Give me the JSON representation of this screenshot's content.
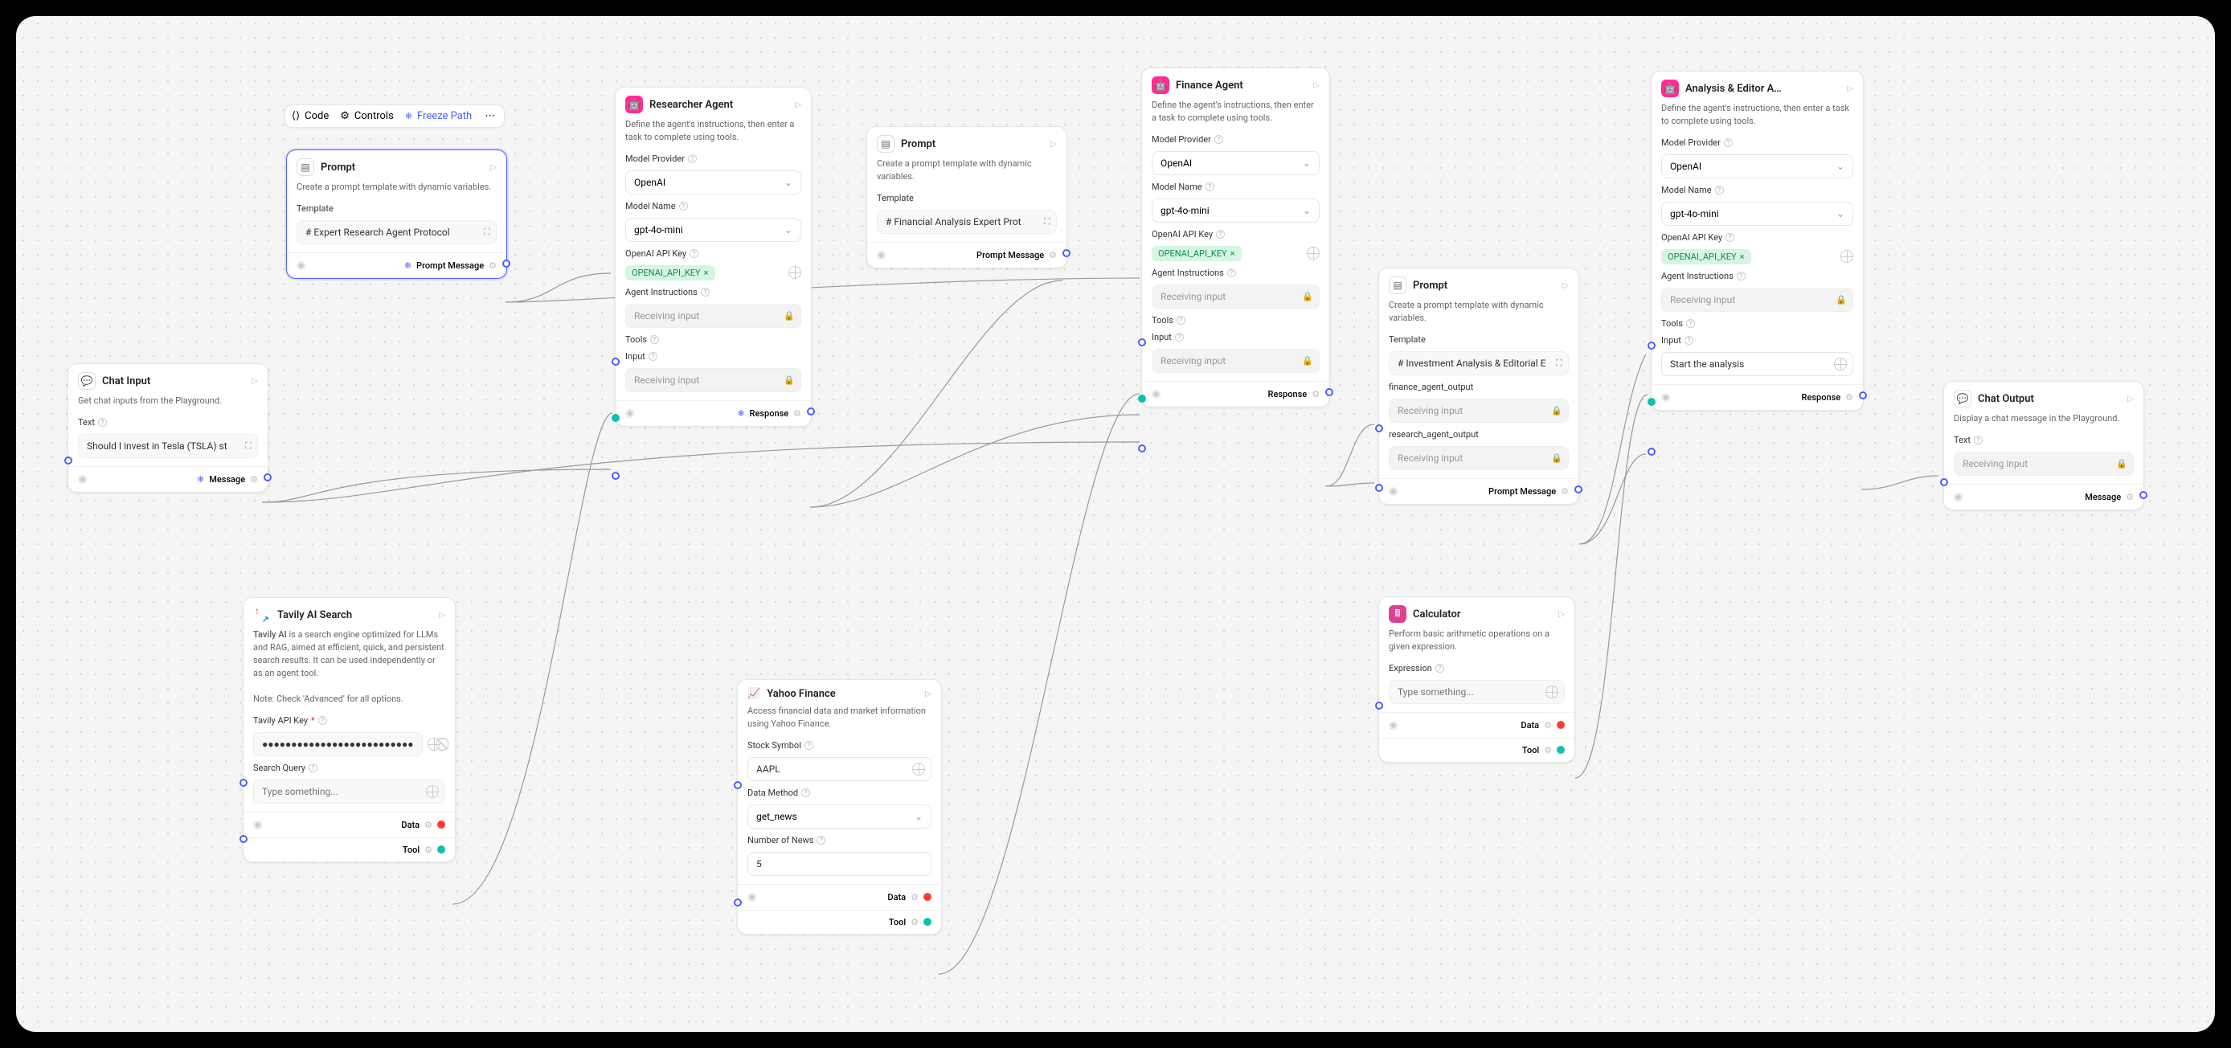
{
  "toolbar": {
    "code": "Code",
    "controls": "Controls",
    "freeze": "Freeze Path"
  },
  "prompt1": {
    "title": "Prompt",
    "desc": "Create a prompt template with dynamic variables.",
    "template_lbl": "Template",
    "template_val": "# Expert Research Agent Protocol",
    "out": "Prompt Message"
  },
  "chatInput": {
    "title": "Chat Input",
    "desc": "Get chat inputs from the Playground.",
    "text_lbl": "Text",
    "text_val": "Should I invest in Tesla (TSLA) st",
    "out": "Message"
  },
  "tavily": {
    "title": "Tavily AI Search",
    "desc1": "Tavily AI is a search engine optimized for LLMs and RAG, aimed at efficient, quick, and persistent search results. It can be used independently or as an agent tool.",
    "desc2": "Note: Check 'Advanced' for all options.",
    "apikey_lbl": "Tavily API Key",
    "apikey_val": "●●●●●●●●●●●●●●●●●●●●●●●●●●●●●",
    "query_lbl": "Search Query",
    "query_ph": "Type something...",
    "out_data": "Data",
    "out_tool": "Tool"
  },
  "researcher": {
    "title": "Researcher Agent",
    "desc": "Define the agent's instructions, then enter a task to complete using tools.",
    "provider_lbl": "Model Provider",
    "provider": "OpenAI",
    "model_lbl": "Model Name",
    "model": "gpt-4o-mini",
    "apikey_lbl": "OpenAI API Key",
    "apikey": "OPENAI_API_KEY",
    "instr_lbl": "Agent Instructions",
    "instr": "Receiving input",
    "tools_lbl": "Tools",
    "input_lbl": "Input",
    "input": "Receiving input",
    "out": "Response"
  },
  "prompt2": {
    "title": "Prompt",
    "desc": "Create a prompt template with dynamic variables.",
    "template_lbl": "Template",
    "template_val": "# Financial Analysis Expert Prot",
    "out": "Prompt Message"
  },
  "yahoo": {
    "title": "Yahoo Finance",
    "desc": "Access financial data and market information using Yahoo Finance.",
    "symbol_lbl": "Stock Symbol",
    "symbol": "AAPL",
    "method_lbl": "Data Method",
    "method": "get_news",
    "news_lbl": "Number of News",
    "news": "5",
    "out_data": "Data",
    "out_tool": "Tool"
  },
  "finance": {
    "title": "Finance Agent",
    "desc": "Define the agent's instructions, then enter a task to complete using tools.",
    "provider_lbl": "Model Provider",
    "provider": "OpenAI",
    "model_lbl": "Model Name",
    "model": "gpt-4o-mini",
    "apikey_lbl": "OpenAI API Key",
    "apikey": "OPENAI_API_KEY",
    "instr_lbl": "Agent Instructions",
    "instr": "Receiving input",
    "tools_lbl": "Tools",
    "input_lbl": "Input",
    "input": "Receiving input",
    "out": "Response"
  },
  "prompt3": {
    "title": "Prompt",
    "desc": "Create a prompt template with dynamic variables.",
    "template_lbl": "Template",
    "template_val": "# Investment Analysis & Editorial E",
    "f1_lbl": "finance_agent_output",
    "f1": "Receiving input",
    "f2_lbl": "research_agent_output",
    "f2": "Receiving input",
    "out": "Prompt Message"
  },
  "calc": {
    "title": "Calculator",
    "desc": "Perform basic arithmetic operations on a given expression.",
    "expr_lbl": "Expression",
    "expr_ph": "Type something...",
    "out_data": "Data",
    "out_tool": "Tool"
  },
  "analysis": {
    "title": "Analysis & Editor A…",
    "desc": "Define the agent's instructions, then enter a task to complete using tools.",
    "provider_lbl": "Model Provider",
    "provider": "OpenAI",
    "model_lbl": "Model Name",
    "model": "gpt-4o-mini",
    "apikey_lbl": "OpenAI API Key",
    "apikey": "OPENAI_API_KEY",
    "instr_lbl": "Agent Instructions",
    "instr": "Receiving input",
    "tools_lbl": "Tools",
    "input_lbl": "Input",
    "input": "Start the analysis",
    "out": "Response"
  },
  "chatOutput": {
    "title": "Chat Output",
    "desc": "Display a chat message in the Playground.",
    "text_lbl": "Text",
    "text": "Receiving input",
    "out": "Message"
  }
}
